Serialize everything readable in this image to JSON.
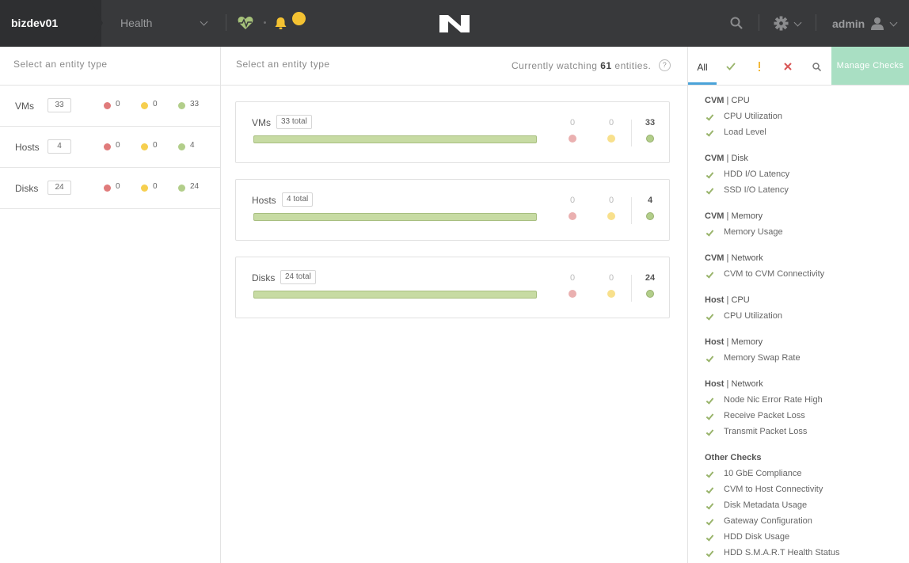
{
  "topbar": {
    "cluster_name": "bizdev01",
    "nav_label": "Health",
    "alert_count": "",
    "user_label": "admin"
  },
  "left": {
    "header": "Select an entity type",
    "rows": [
      {
        "name": "VMs",
        "count": "33",
        "red": "0",
        "yellow": "0",
        "green": "33"
      },
      {
        "name": "Hosts",
        "count": "4",
        "red": "0",
        "yellow": "0",
        "green": "4"
      },
      {
        "name": "Disks",
        "count": "24",
        "red": "0",
        "yellow": "0",
        "green": "24"
      }
    ]
  },
  "middle": {
    "header": "Select an entity type",
    "watching_prefix": "Currently watching",
    "watching_count": "61",
    "watching_suffix": "entities.",
    "help": "?",
    "cards": [
      {
        "name": "VMs",
        "total": "33 total",
        "red": "0",
        "yellow": "0",
        "green": "33"
      },
      {
        "name": "Hosts",
        "total": "4 total",
        "red": "0",
        "yellow": "0",
        "green": "4"
      },
      {
        "name": "Disks",
        "total": "24 total",
        "red": "0",
        "yellow": "0",
        "green": "24"
      }
    ]
  },
  "right": {
    "tabs": {
      "all": "All"
    },
    "manage_checks": "Manage Checks",
    "groups": [
      {
        "entity": "CVM",
        "sep": " | ",
        "type": "CPU",
        "checks": [
          "CPU Utilization",
          "Load Level"
        ]
      },
      {
        "entity": "CVM",
        "sep": " | ",
        "type": "Disk",
        "checks": [
          "HDD I/O Latency",
          "SSD I/O Latency"
        ]
      },
      {
        "entity": "CVM",
        "sep": " | ",
        "type": "Memory",
        "checks": [
          "Memory Usage"
        ]
      },
      {
        "entity": "CVM",
        "sep": " | ",
        "type": "Network",
        "checks": [
          "CVM to CVM Connectivity"
        ]
      },
      {
        "entity": "Host",
        "sep": " | ",
        "type": "CPU",
        "checks": [
          "CPU Utilization"
        ]
      },
      {
        "entity": "Host",
        "sep": " | ",
        "type": "Memory",
        "checks": [
          "Memory Swap Rate"
        ]
      },
      {
        "entity": "Host",
        "sep": " | ",
        "type": "Network",
        "checks": [
          "Node Nic Error Rate High",
          "Receive Packet Loss",
          "Transmit Packet Loss"
        ]
      },
      {
        "entity": "Other Checks",
        "sep": "",
        "type": "",
        "checks": [
          "10 GbE Compliance",
          "CVM to Host Connectivity",
          "Disk Metadata Usage",
          "Gateway Configuration",
          "HDD Disk Usage",
          "HDD S.M.A.R.T Health Status"
        ]
      }
    ]
  },
  "colors": {
    "critical": "#e07b7b",
    "warning": "#f6cf4f",
    "good": "#b2ce8a",
    "accent": "#4aa3d9",
    "manage": "#a9dfc3"
  }
}
